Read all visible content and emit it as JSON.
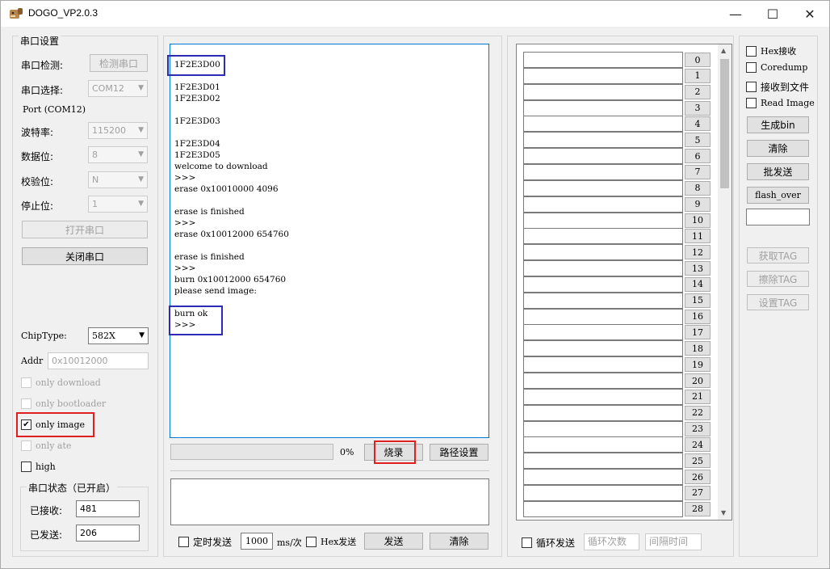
{
  "window": {
    "title": "DOGO_VP2.0.3",
    "minimize": "—",
    "maximize": "☐",
    "close": "✕"
  },
  "serial": {
    "group_title": "串口设置",
    "detect_label": "串口检测:",
    "detect_button": "检测串口",
    "select_label": "串口选择:",
    "select_value": "COM12",
    "port_text": "Port (COM12)",
    "baud_label": "波特率:",
    "baud_value": "115200",
    "databits_label": "数据位:",
    "databits_value": "8",
    "parity_label": "校验位:",
    "parity_value": "N",
    "stopbits_label": "停止位:",
    "stopbits_value": "1",
    "open_button": "打开串口",
    "close_button": "关闭串口"
  },
  "chip": {
    "type_label": "ChipType:",
    "type_value": "582X",
    "addr_label": "Addr",
    "addr_placeholder": "0x10012000",
    "only_download": "only download",
    "only_bootloader": "only bootloader",
    "only_image": "only image",
    "only_image_checked": true,
    "only_ate": "only ate",
    "high": "high"
  },
  "status": {
    "group_title": "串口状态（已开启）",
    "received_label": "已接收:",
    "received_value": "481",
    "sent_label": "已发送:",
    "sent_value": "206"
  },
  "log_lines": [
    "",
    "1F2E3D00",
    "",
    "1F2E3D01",
    "1F2E3D02",
    "",
    "1F2E3D03",
    "",
    "1F2E3D04",
    "1F2E3D05",
    "welcome to download",
    ">>>",
    "erase 0x10010000 4096",
    "",
    "erase is finished",
    ">>>",
    "erase 0x10012000 654760",
    "",
    "erase is finished",
    ">>>",
    "burn 0x10012000 654760",
    "please send image:",
    "",
    "burn ok",
    ">>>"
  ],
  "burn": {
    "progress": 0,
    "progress_text": "0%",
    "burn_button": "烧录",
    "path_button": "路径设置"
  },
  "send": {
    "timed_send": "定时发送",
    "interval": "1000",
    "interval_unit": "ms/次",
    "hex_send": "Hex发送",
    "send_button": "发送",
    "clear_button": "清除"
  },
  "list": {
    "rows": [
      "0",
      "1",
      "2",
      "3",
      "4",
      "5",
      "6",
      "7",
      "8",
      "9",
      "10",
      "11",
      "12",
      "13",
      "14",
      "15",
      "16",
      "17",
      "18",
      "19",
      "20",
      "21",
      "22",
      "23",
      "24",
      "25",
      "26",
      "27",
      "28"
    ],
    "loop_send": "循环发送",
    "loop_count_placeholder": "循环次数",
    "interval_placeholder": "间隔时间"
  },
  "right": {
    "hex_receive": "Hex接收",
    "coredump": "Coredump",
    "receive_to_file": "接收到文件",
    "read_image": "Read Image",
    "gen_bin": "生成bin",
    "clear": "清除",
    "batch_send": "批发送",
    "flash_over": "flash_over",
    "get_tag": "获取TAG",
    "erase_tag": "擦除TAG",
    "set_tag": "设置TAG"
  }
}
